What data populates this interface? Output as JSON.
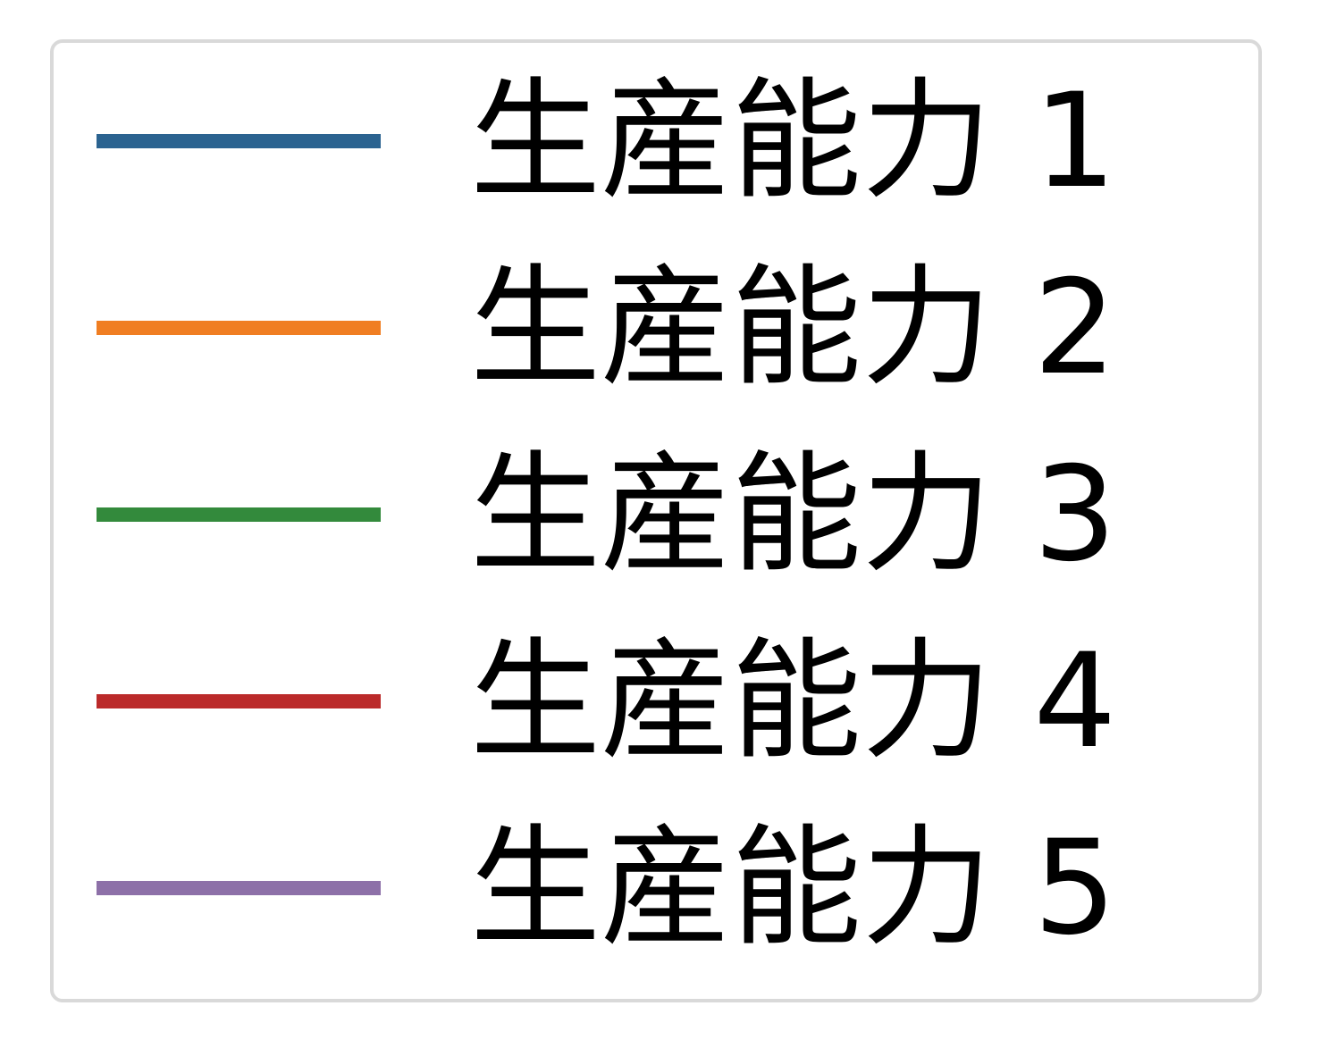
{
  "chart_data": {
    "type": "line",
    "legend": {
      "placement": "box",
      "entries": [
        {
          "label": "生産能力 1",
          "color": "#2b6390"
        },
        {
          "label": "生産能力 2",
          "color": "#f07e22"
        },
        {
          "label": "生産能力 3",
          "color": "#338a3c"
        },
        {
          "label": "生産能力 4",
          "color": "#bb2a2a"
        },
        {
          "label": "生産能力 5",
          "color": "#8d70a8"
        }
      ]
    }
  }
}
